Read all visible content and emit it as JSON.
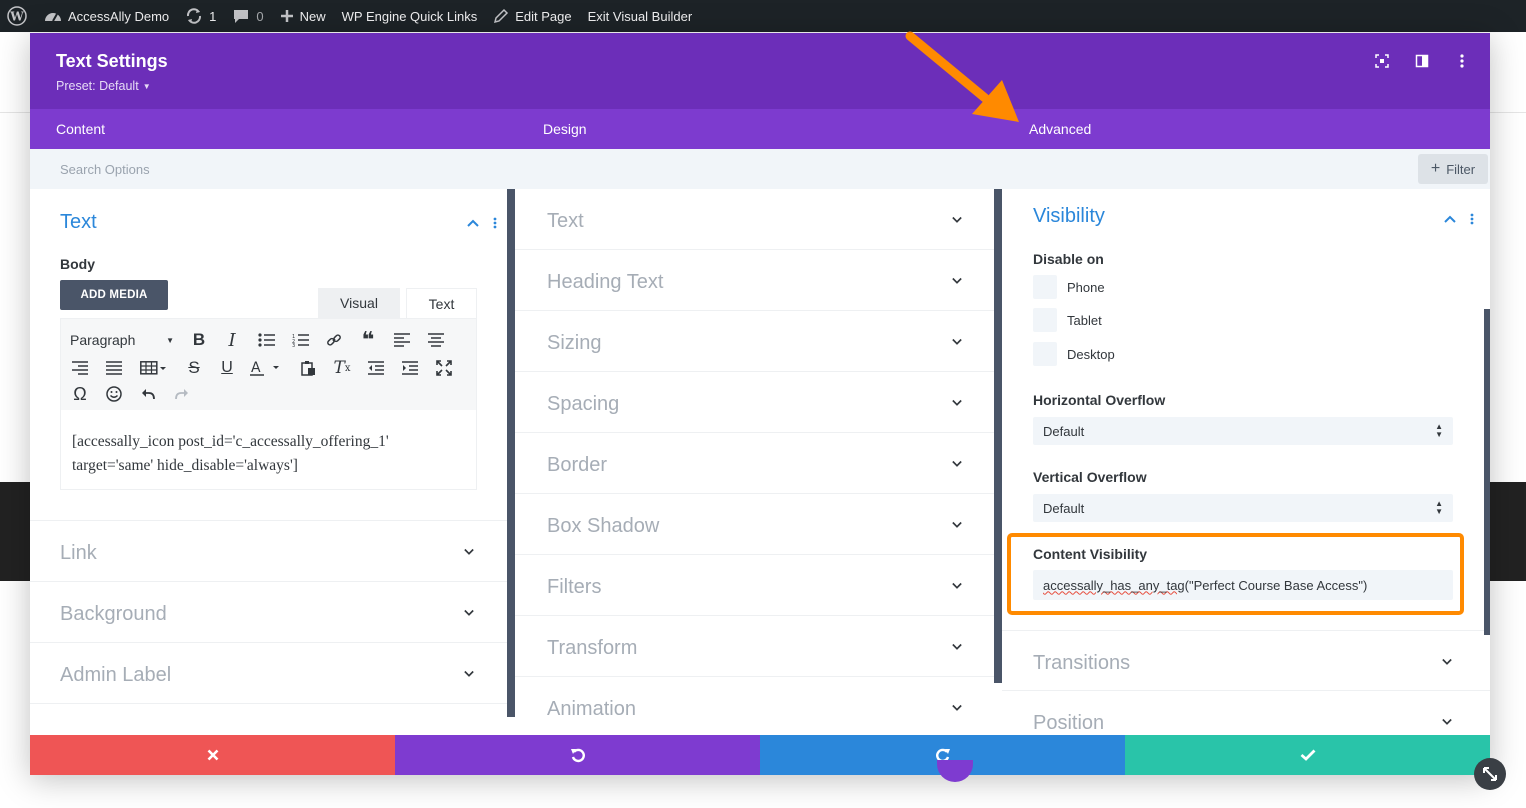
{
  "adminbar": {
    "site_name": "AccessAlly Demo",
    "updates_count": "1",
    "comments_count": "0",
    "new_label": "New",
    "quick_links_label": "WP Engine Quick Links",
    "edit_page_label": "Edit Page",
    "exit_builder_label": "Exit Visual Builder"
  },
  "modal": {
    "title": "Text Settings",
    "preset": "Preset: Default",
    "tabs": [
      {
        "label": "Content"
      },
      {
        "label": "Design"
      },
      {
        "label": "Advanced"
      }
    ],
    "search_placeholder": "Search Options",
    "filter_label": "Filter"
  },
  "content_col": {
    "open_section": {
      "title": "Text",
      "body_label": "Body",
      "add_media_label": "ADD MEDIA",
      "tab_visual": "Visual",
      "tab_text": "Text",
      "paragraph_label": "Paragraph",
      "content": "[accessally_icon post_id='c_accessally_offering_1' target='same' hide_disable='always']"
    },
    "sections": [
      {
        "label": "Link"
      },
      {
        "label": "Background"
      },
      {
        "label": "Admin Label"
      }
    ]
  },
  "design_col": {
    "sections": [
      {
        "label": "Text"
      },
      {
        "label": "Heading Text"
      },
      {
        "label": "Sizing"
      },
      {
        "label": "Spacing"
      },
      {
        "label": "Border"
      },
      {
        "label": "Box Shadow"
      },
      {
        "label": "Filters"
      },
      {
        "label": "Transform"
      },
      {
        "label": "Animation"
      }
    ]
  },
  "advanced_col": {
    "visibility": {
      "title": "Visibility",
      "disable_on_label": "Disable on",
      "options": [
        {
          "label": "Phone"
        },
        {
          "label": "Tablet"
        },
        {
          "label": "Desktop"
        }
      ],
      "horizontal_overflow_label": "Horizontal Overflow",
      "horizontal_overflow_value": "Default",
      "vertical_overflow_label": "Vertical Overflow",
      "vertical_overflow_value": "Default",
      "content_visibility_label": "Content Visibility",
      "content_visibility_fn": "accessally_has_any_tag",
      "content_visibility_args": "(\"Perfect Course Base Access\")"
    },
    "sections": [
      {
        "label": "Transitions"
      },
      {
        "label": "Position"
      }
    ]
  },
  "colors": {
    "header_purple": "#6c2eb9",
    "tabs_purple": "#7d3bcf",
    "accent_blue": "#2b87da",
    "cancel_red": "#ef5555",
    "save_green": "#29c4a9",
    "highlight_orange": "#ff8a00"
  }
}
